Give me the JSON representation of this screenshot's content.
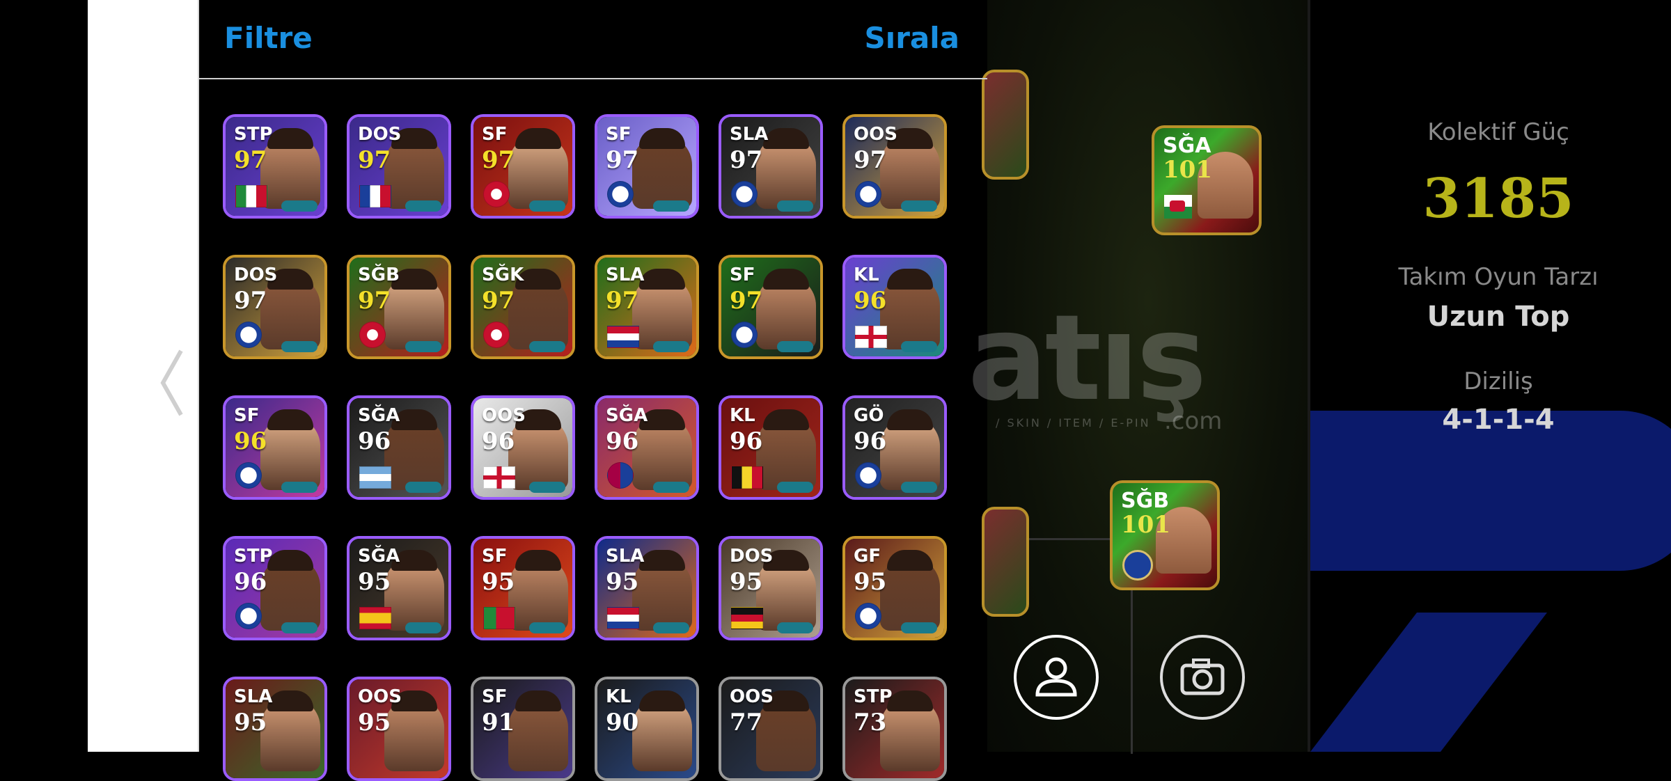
{
  "header": {
    "filter_label": "Filtre",
    "sort_label": "Sırala"
  },
  "team": {
    "power_label": "Kolektif Güç",
    "power_value": "3185",
    "style_label": "Takım Oyun Tarzı",
    "style_value": "Uzun Top",
    "formation_label": "Diziliş",
    "formation_value": "4-1-1-4"
  },
  "pitch_players": [
    {
      "pos": "SĞA",
      "rating": "101"
    },
    {
      "pos": "SĞB",
      "rating": "101"
    }
  ],
  "players": [
    {
      "pos": "STP",
      "rating": "97",
      "flag": "italy"
    },
    {
      "pos": "DOS",
      "rating": "97",
      "flag": "france"
    },
    {
      "pos": "SF",
      "rating": "97",
      "flag": "arsenal-crest"
    },
    {
      "pos": "SF",
      "rating": "97",
      "flag": "club-crest"
    },
    {
      "pos": "SLA",
      "rating": "97",
      "flag": "club-crest"
    },
    {
      "pos": "OOS",
      "rating": "97",
      "flag": "club-crest"
    },
    {
      "pos": "DOS",
      "rating": "97",
      "flag": "club-crest"
    },
    {
      "pos": "SĞB",
      "rating": "97",
      "flag": "arsenal-crest"
    },
    {
      "pos": "SĞK",
      "rating": "97",
      "flag": "arsenal-crest"
    },
    {
      "pos": "SLA",
      "rating": "97",
      "flag": "netherlands"
    },
    {
      "pos": "SF",
      "rating": "97",
      "flag": "club-crest"
    },
    {
      "pos": "KL",
      "rating": "96",
      "flag": "england"
    },
    {
      "pos": "SF",
      "rating": "96",
      "flag": "club-crest"
    },
    {
      "pos": "SĞA",
      "rating": "96",
      "flag": "argentina"
    },
    {
      "pos": "OOS",
      "rating": "96",
      "flag": "england"
    },
    {
      "pos": "SĞA",
      "rating": "96",
      "flag": "barcelona-crest"
    },
    {
      "pos": "KL",
      "rating": "96",
      "flag": "belgium"
    },
    {
      "pos": "GÖ",
      "rating": "96",
      "flag": "club-crest"
    },
    {
      "pos": "STP",
      "rating": "96",
      "flag": "club-crest"
    },
    {
      "pos": "SĞA",
      "rating": "95",
      "flag": "spain"
    },
    {
      "pos": "SF",
      "rating": "95",
      "flag": "portugal"
    },
    {
      "pos": "SLA",
      "rating": "95",
      "flag": "netherlands"
    },
    {
      "pos": "DOS",
      "rating": "95",
      "flag": "germany"
    },
    {
      "pos": "GF",
      "rating": "95",
      "flag": "club-crest"
    },
    {
      "pos": "SLA",
      "rating": "95",
      "flag": ""
    },
    {
      "pos": "OOS",
      "rating": "95",
      "flag": ""
    },
    {
      "pos": "SF",
      "rating": "91",
      "flag": ""
    },
    {
      "pos": "KL",
      "rating": "90",
      "flag": ""
    },
    {
      "pos": "OOS",
      "rating": "77",
      "flag": ""
    },
    {
      "pos": "STP",
      "rating": "73",
      "flag": ""
    }
  ],
  "watermark": {
    "text": "atış",
    "sub": "/ SKIN / ITEM / E-PIN",
    "com": ".com"
  },
  "colors": {
    "accent": "#1a8fe0",
    "power": "#b7b41a"
  },
  "icons": {
    "back": "chevron-left-icon",
    "profile": "person-icon",
    "camera": "camera-icon"
  }
}
